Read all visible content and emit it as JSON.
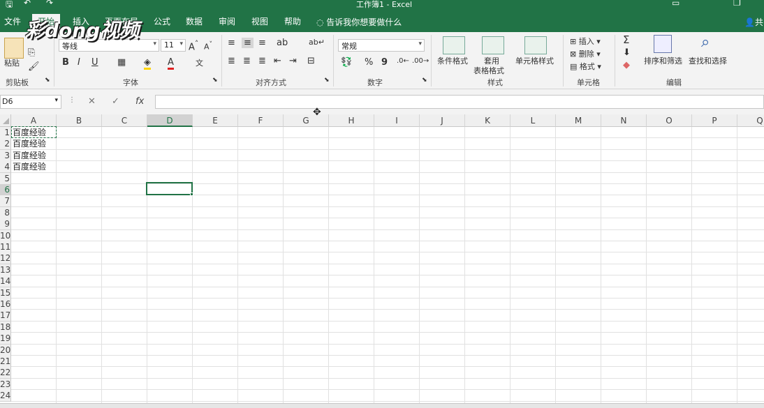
{
  "window": {
    "title": "工作簿1  -  Excel"
  },
  "tabs": [
    "文件",
    "开始",
    "插入",
    "页面布局",
    "公式",
    "数据",
    "审阅",
    "视图",
    "帮助"
  ],
  "tell_me": "告诉我你想要做什么",
  "share": "共",
  "watermark": "彩dong视频",
  "ribbon": {
    "clipboard": {
      "paste": "粘贴",
      "label": "剪贴板"
    },
    "font": {
      "name": "等线",
      "size": "11",
      "label": "字体",
      "bold": "B",
      "italic": "I",
      "underline": "U",
      "grow": "A",
      "shrink": "A",
      "color": "A",
      "phonetic": "文"
    },
    "alignment": {
      "label": "对齐方式"
    },
    "number": {
      "format": "常规",
      "label": "数字",
      "percent": "%",
      "comma": "9"
    },
    "styles": {
      "conditional": "条件格式",
      "table1": "套用",
      "table2": "表格格式",
      "cell_styles": "单元格样式",
      "label": "样式"
    },
    "cells": {
      "insert": "插入",
      "delete": "删除",
      "format": "格式",
      "label": "单元格"
    },
    "editing": {
      "sum": "Σ",
      "sort": "排序和筛选",
      "find": "查找和选择",
      "label": "编辑"
    }
  },
  "formula_bar": {
    "name_box": "D6",
    "fx": "fx",
    "cancel": "✕",
    "enter": "✓",
    "content": ""
  },
  "columns": [
    "A",
    "B",
    "C",
    "D",
    "E",
    "F",
    "G",
    "H",
    "I",
    "J",
    "K",
    "L",
    "M",
    "N",
    "O",
    "P",
    "Q"
  ],
  "rows": [
    "1",
    "2",
    "3",
    "4",
    "5",
    "6",
    "7",
    "8",
    "9",
    "10",
    "11",
    "12",
    "13",
    "14",
    "15",
    "16",
    "17",
    "18",
    "19",
    "20",
    "21",
    "22",
    "23",
    "24"
  ],
  "cells": [
    {
      "ref": "A1",
      "value": "百度经验"
    },
    {
      "ref": "A2",
      "value": "百度经验"
    },
    {
      "ref": "A3",
      "value": "百度经验"
    },
    {
      "ref": "A4",
      "value": "百度经验"
    }
  ],
  "selected_cell": "D6",
  "colors": {
    "accent": "#217346",
    "ribbon_bg": "#f3f3f3",
    "header_bg": "#efefef",
    "gridline": "#e1e1e1"
  }
}
